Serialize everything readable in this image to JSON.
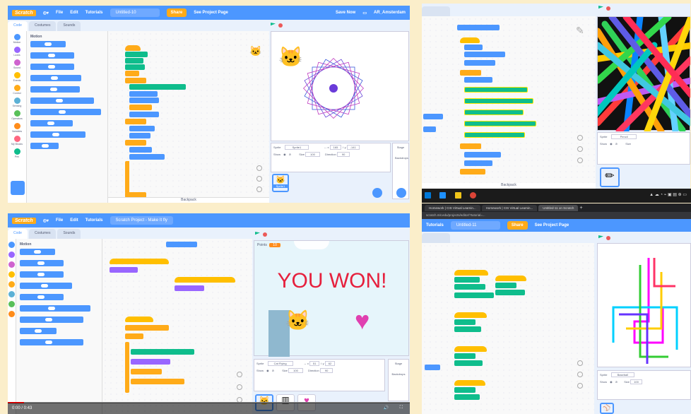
{
  "top_left": {
    "menu": {
      "logo": "Scratch",
      "file": "File",
      "edit": "Edit",
      "tutorials": "Tutorials",
      "project_name": "Untitled-10",
      "share": "Share",
      "see_project_page": "See Project Page",
      "save_now": "Save Now",
      "user": "AR_Amsterdam"
    },
    "tabs": [
      "Code",
      "Costumes",
      "Sounds"
    ],
    "categories": [
      {
        "label": "Motion",
        "color": "#4c97ff"
      },
      {
        "label": "Looks",
        "color": "#9966ff"
      },
      {
        "label": "Sound",
        "color": "#cf63cf"
      },
      {
        "label": "Events",
        "color": "#ffbf00"
      },
      {
        "label": "Control",
        "color": "#ffab19"
      },
      {
        "label": "Sensing",
        "color": "#5cb1d6"
      },
      {
        "label": "Operators",
        "color": "#59c059"
      },
      {
        "label": "Variables",
        "color": "#ff8c1a"
      },
      {
        "label": "My Blocks",
        "color": "#ff6680"
      },
      {
        "label": "Pen",
        "color": "#0fbd8c"
      }
    ],
    "palette_heading": "Motion",
    "sprite_panel": {
      "sprite_label": "Sprite",
      "sprite_name": "Sprite1",
      "x": "165",
      "y": "-141",
      "show": "Show",
      "size": "Size",
      "size_val": "100",
      "direction": "Direction",
      "dir_val": "90",
      "stage": "Stage",
      "backdrops": "Backdrops"
    },
    "sprite_thumb": "Sprite1",
    "backpack": "Backpack"
  },
  "top_right": {
    "sprite_label": "Sprite",
    "sprite_name": "Pencil",
    "show": "Show",
    "size": "Size",
    "backpack": "Backpack"
  },
  "taskbar": {
    "tabs": [
      "Homework | CIS Virtual Learnin...",
      "Homework | CIS Virtual Learnin...",
      "Untitled-11 on Scratch"
    ],
    "url": "scratch.mit.edu/projects/editor/?tutorial=..."
  },
  "bottom_right": {
    "tutorials": "Tutorials",
    "project_name": "Untitled-11",
    "share": "Share",
    "see_project_page": "See Project Page",
    "sprite_label": "Sprite",
    "sprite_name": "Baseball",
    "show": "Show",
    "size": "Size",
    "size_val": "100"
  },
  "bottom_left": {
    "menu": {
      "logo": "Scratch",
      "file": "File",
      "edit": "Edit",
      "tutorials": "Tutorials",
      "project_name": "Scratch Project - Make It fly"
    },
    "tabs": [
      "Code",
      "Costumes",
      "Sounds"
    ],
    "palette_heading": "Motion",
    "points_label": "Points",
    "points_value": "10",
    "won_text": "YOU WON!",
    "sprite_panel": {
      "sprite_label": "Sprite",
      "sprite_name": "Cat Flying",
      "x": "51",
      "y": "62",
      "show": "Show",
      "size": "Size",
      "size_val": "100",
      "direction": "Direction",
      "dir_val": "90",
      "stage": "Stage",
      "backdrops": "Backdrops"
    },
    "video_time": "0:00 / 0:43",
    "video_progress": 0.04
  }
}
